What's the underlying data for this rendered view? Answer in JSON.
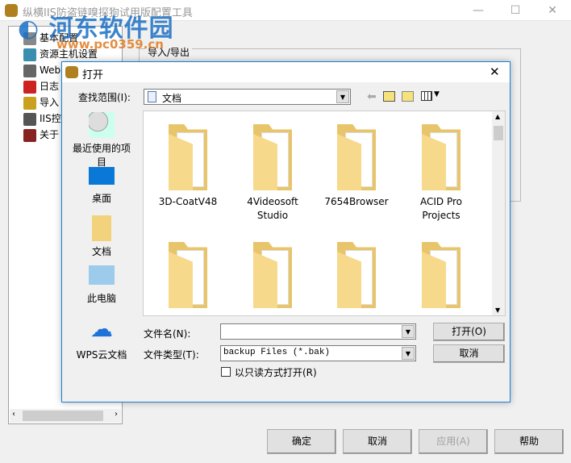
{
  "main": {
    "title": "纵横IIS防盗链嗅探狗试用版配置工具",
    "watermark": "河东软件园",
    "watermark_url": "www.pc0359.cn",
    "tree": [
      {
        "label": "基本配置",
        "color": "#888"
      },
      {
        "label": "资源主机设置",
        "color": "#3a8fb0"
      },
      {
        "label": "Web",
        "color": "#666"
      },
      {
        "label": "日志",
        "color": "#c22"
      },
      {
        "label": "导入",
        "color": "#c9a020"
      },
      {
        "label": "IIS控",
        "color": "#555"
      },
      {
        "label": "关于",
        "color": "#822"
      }
    ],
    "group_label": "导入/导出",
    "buttons": {
      "ok": "确定",
      "cancel": "取消",
      "apply": "应用(A)",
      "help": "帮助"
    }
  },
  "dialog": {
    "title": "打开",
    "look_in_label": "查找范围(I):",
    "look_in_value": "文档",
    "places": [
      "最近使用的项目",
      "桌面",
      "文档",
      "此电脑",
      "WPS云文档"
    ],
    "files": [
      "3D-CoatV48",
      "4Videosoft Studio",
      "7654Browser",
      "ACID Pro Projects",
      "",
      "",
      "",
      ""
    ],
    "filename_label": "文件名(N):",
    "filename_value": "",
    "filetype_label": "文件类型(T):",
    "filetype_value": "backup Files (*.bak)",
    "readonly_label": "以只读方式打开(R)",
    "open_button": "打开(O)",
    "cancel_button": "取消"
  }
}
